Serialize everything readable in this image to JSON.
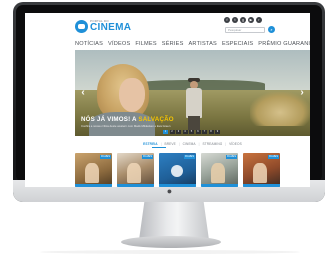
{
  "site": {
    "logo_small": "PORTAL DO",
    "logo_big": "CINEMA",
    "search_placeholder": "Pesquisar",
    "search_button_icon": "search-icon",
    "social_icons": [
      "facebook-icon",
      "twitter-icon",
      "google-plus-icon",
      "youtube-icon",
      "rss-icon"
    ]
  },
  "nav": {
    "items": [
      "NOTÍCIAS",
      "VÍDEOS",
      "FILMES",
      "SÉRIES",
      "ARTISTAS",
      "ESPECIAIS",
      "PRÊMIO GUARANI"
    ]
  },
  "hero": {
    "title_prefix": "NÓS JÁ VIMOS! A",
    "title_accent": "SALVAÇÃO",
    "subtitle": "Confira a nossa crítica deste western com Mads Mikkelsen e Eva Green",
    "dots": [
      "1",
      "2",
      "3",
      "4",
      "5",
      "6",
      "7",
      "8",
      "9"
    ],
    "active_dot": 0
  },
  "categories": {
    "items": [
      "ESTREIA",
      "BREVE",
      "CINEMA",
      "STREAMING",
      "VÍDEOS"
    ],
    "active": 0
  },
  "thumbnails": [
    {
      "badge": "FILMES"
    },
    {
      "badge": "FILMES"
    },
    {
      "badge": "FILMES"
    },
    {
      "badge": "FILMES"
    },
    {
      "badge": "FILMES"
    }
  ],
  "colors": {
    "accent": "#1f90d8",
    "highlight": "#f5c400",
    "nav_text": "#4d5157"
  }
}
